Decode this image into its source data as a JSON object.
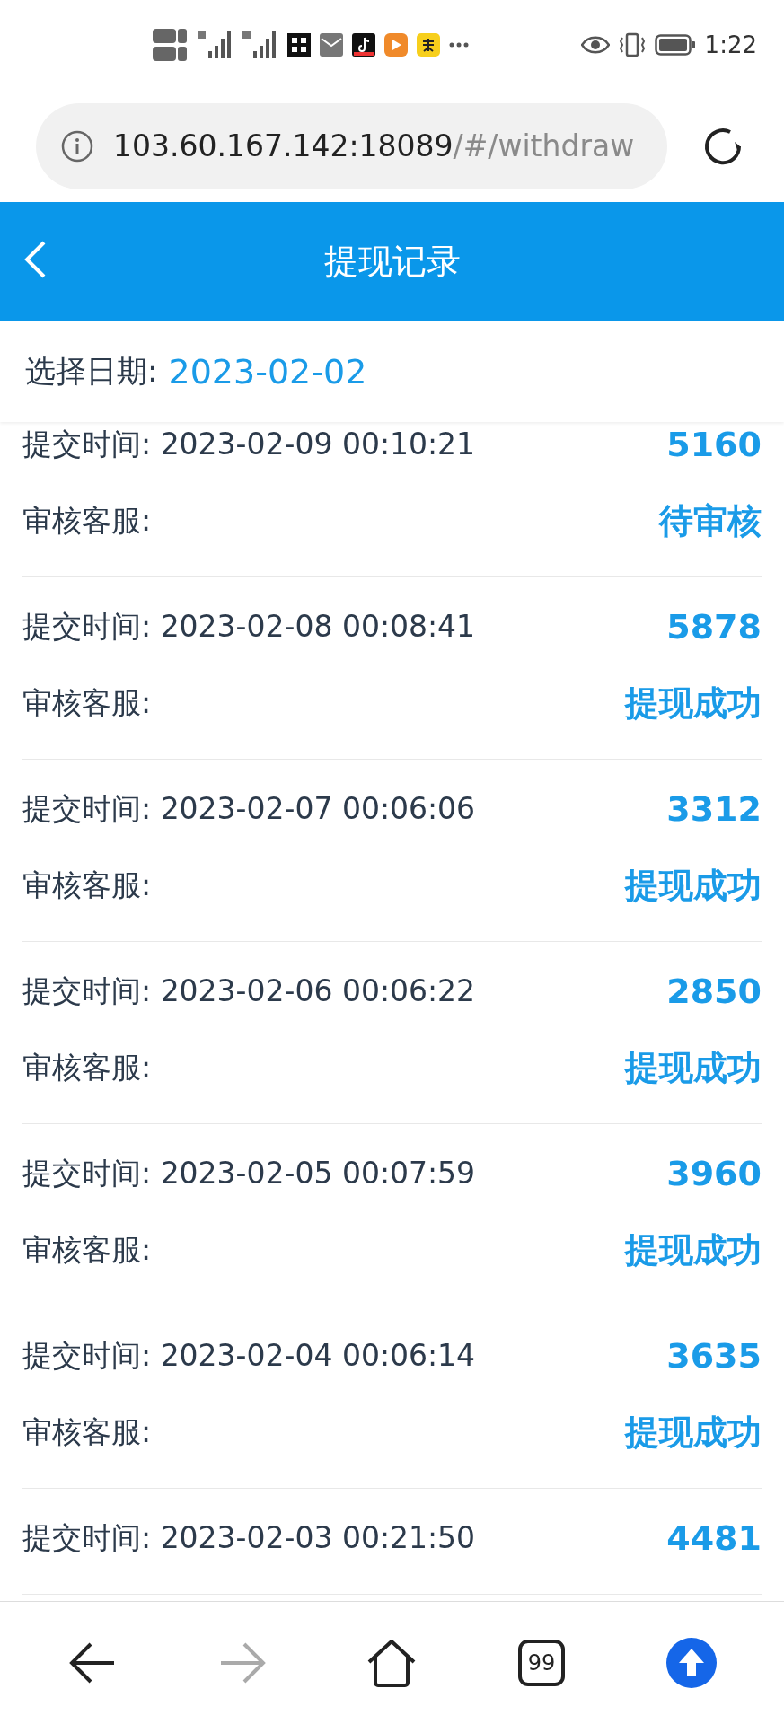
{
  "status_bar": {
    "time": "1:22"
  },
  "address_bar": {
    "host": "103.60.167.142:18089",
    "path": "/#/withdraw"
  },
  "header": {
    "title": "提现记录"
  },
  "date_filter": {
    "label": "选择日期:",
    "value": "2023-02-02"
  },
  "records": [
    {
      "submitted_label": "提交时间:",
      "submitted": "2023-02-09 00:10:21",
      "amount": "5160",
      "reviewer_label": "审核客服:",
      "status": "待审核"
    },
    {
      "submitted_label": "提交时间:",
      "submitted": "2023-02-08 00:08:41",
      "amount": "5878",
      "reviewer_label": "审核客服:",
      "status": "提现成功"
    },
    {
      "submitted_label": "提交时间:",
      "submitted": "2023-02-07 00:06:06",
      "amount": "3312",
      "reviewer_label": "审核客服:",
      "status": "提现成功"
    },
    {
      "submitted_label": "提交时间:",
      "submitted": "2023-02-06 00:06:22",
      "amount": "2850",
      "reviewer_label": "审核客服:",
      "status": "提现成功"
    },
    {
      "submitted_label": "提交时间:",
      "submitted": "2023-02-05 00:07:59",
      "amount": "3960",
      "reviewer_label": "审核客服:",
      "status": "提现成功"
    },
    {
      "submitted_label": "提交时间:",
      "submitted": "2023-02-04 00:06:14",
      "amount": "3635",
      "reviewer_label": "审核客服:",
      "status": "提现成功"
    },
    {
      "submitted_label": "提交时间:",
      "submitted": "2023-02-03 00:21:50",
      "amount": "4481"
    }
  ],
  "nav": [
    {
      "kind": "back",
      "disabled": false
    },
    {
      "kind": "forward",
      "disabled": true
    },
    {
      "kind": "home",
      "disabled": false
    },
    {
      "kind": "tabs",
      "count": "99",
      "disabled": false
    },
    {
      "kind": "up",
      "disabled": false
    }
  ]
}
